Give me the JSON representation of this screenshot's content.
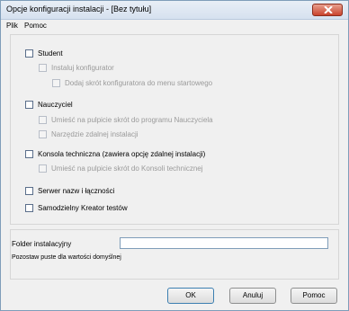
{
  "window": {
    "title": "Opcje konfiguracji instalacji - [Bez tytułu]"
  },
  "menu": {
    "items": [
      {
        "label": "Plik"
      },
      {
        "label": "Pomoc"
      }
    ]
  },
  "options": {
    "student": {
      "label": "Student",
      "checked": false,
      "enabled": true
    },
    "install_configurator": {
      "label": "Instaluj konfigurator",
      "checked": false,
      "enabled": false
    },
    "add_configurator_shortcut": {
      "label": "Dodaj skrót konfiguratora do menu startowego",
      "checked": false,
      "enabled": false
    },
    "teacher": {
      "label": "Nauczyciel",
      "checked": false,
      "enabled": true
    },
    "teacher_desktop_shortcut": {
      "label": "Umieść na pulpicie skrót do programu Nauczyciela",
      "checked": false,
      "enabled": false
    },
    "teacher_remote_tools": {
      "label": "Narzędzie zdalnej instalacji",
      "checked": false,
      "enabled": false
    },
    "tech_console": {
      "label": "Konsola techniczna (zawiera opcję zdalnej instalacji)",
      "checked": false,
      "enabled": true
    },
    "tech_console_shortcut": {
      "label": "Umieść na pulpicie skrót do Konsoli technicznej",
      "checked": false,
      "enabled": false
    },
    "name_server": {
      "label": "Serwer nazw i łączności",
      "checked": false,
      "enabled": true
    },
    "test_wizard": {
      "label": "Samodzielny Kreator testów",
      "checked": false,
      "enabled": true
    }
  },
  "install_folder": {
    "label": "Folder instalacyjny",
    "value": "",
    "hint": "Pozostaw puste dla wartości domyślnej"
  },
  "buttons": {
    "ok": "OK",
    "cancel": "Anuluj",
    "help": "Pomoc"
  },
  "colors": {
    "titlebar": "#d6e1ef",
    "close_button": "#c9432d",
    "disabled_text": "#9a9a9a"
  }
}
